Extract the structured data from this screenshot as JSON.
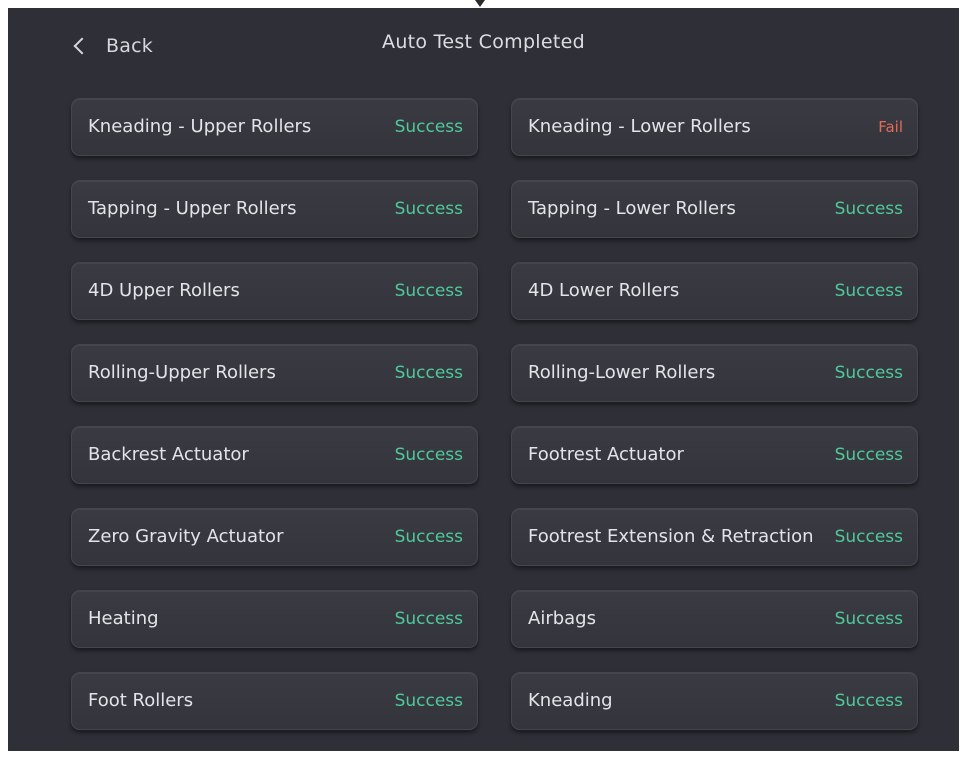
{
  "header": {
    "back_label": "Back",
    "title": "Auto Test Completed"
  },
  "colors": {
    "background": "#2f3037",
    "card": "#383940",
    "success": "#4fc99a",
    "fail": "#e36a57"
  },
  "icons": {
    "back": "chevron-left-icon"
  },
  "tests": [
    {
      "name": "Kneading - Upper Rollers",
      "status": "Success"
    },
    {
      "name": "Kneading - Lower Rollers",
      "status": "Fail"
    },
    {
      "name": "Tapping - Upper Rollers",
      "status": "Success"
    },
    {
      "name": "Tapping - Lower Rollers",
      "status": "Success"
    },
    {
      "name": "4D Upper Rollers",
      "status": "Success"
    },
    {
      "name": "4D Lower Rollers",
      "status": "Success"
    },
    {
      "name": "Rolling-Upper Rollers",
      "status": "Success"
    },
    {
      "name": "Rolling-Lower Rollers",
      "status": "Success"
    },
    {
      "name": "Backrest Actuator",
      "status": "Success"
    },
    {
      "name": "Footrest Actuator",
      "status": "Success"
    },
    {
      "name": "Zero Gravity Actuator",
      "status": "Success"
    },
    {
      "name": "Footrest Extension & Retraction",
      "status": "Success"
    },
    {
      "name": "Heating",
      "status": "Success"
    },
    {
      "name": "Airbags",
      "status": "Success"
    },
    {
      "name": "Foot Rollers",
      "status": "Success"
    },
    {
      "name": "Kneading",
      "status": "Success"
    }
  ]
}
